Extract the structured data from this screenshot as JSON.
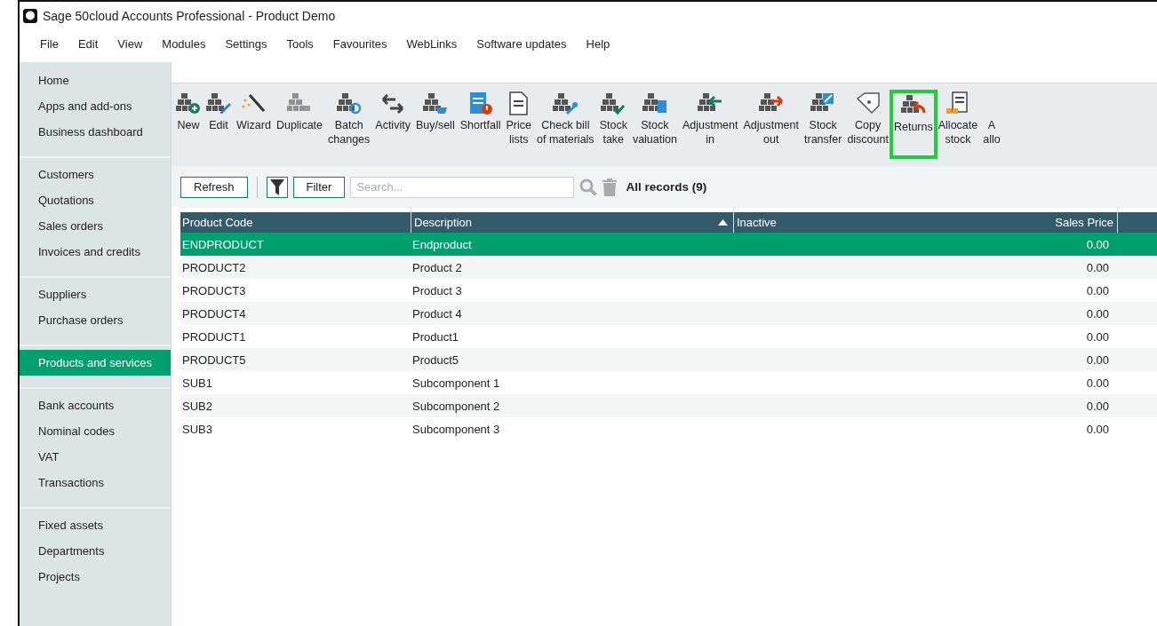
{
  "window": {
    "title": "Sage 50cloud Accounts Professional - Product Demo"
  },
  "menu": [
    "File",
    "Edit",
    "View",
    "Modules",
    "Settings",
    "Tools",
    "Favourites",
    "WebLinks",
    "Software updates",
    "Help"
  ],
  "sidebar": {
    "groups": [
      {
        "items": [
          {
            "label": "Home",
            "selected": false
          },
          {
            "label": "Apps and add-ons",
            "selected": false
          },
          {
            "label": "Business dashboard",
            "selected": false
          }
        ]
      },
      {
        "items": [
          {
            "label": "Customers",
            "selected": false
          },
          {
            "label": "Quotations",
            "selected": false
          },
          {
            "label": "Sales orders",
            "selected": false
          },
          {
            "label": "Invoices and credits",
            "selected": false
          }
        ]
      },
      {
        "items": [
          {
            "label": "Suppliers",
            "selected": false
          },
          {
            "label": "Purchase orders",
            "selected": false
          }
        ]
      },
      {
        "items": [
          {
            "label": "Products and services",
            "selected": true
          }
        ]
      },
      {
        "items": [
          {
            "label": "Bank accounts",
            "selected": false
          },
          {
            "label": "Nominal codes",
            "selected": false
          },
          {
            "label": "VAT",
            "selected": false
          },
          {
            "label": "Transactions",
            "selected": false
          }
        ]
      },
      {
        "items": [
          {
            "label": "Fixed assets",
            "selected": false
          },
          {
            "label": "Departments",
            "selected": false
          },
          {
            "label": "Projects",
            "selected": false
          }
        ]
      }
    ]
  },
  "toolbar": [
    {
      "lines": [
        "New"
      ],
      "highlighted": false
    },
    {
      "lines": [
        "Edit"
      ],
      "highlighted": false
    },
    {
      "lines": [
        "Wizard"
      ],
      "highlighted": false
    },
    {
      "lines": [
        "Duplicate"
      ],
      "highlighted": false
    },
    {
      "lines": [
        "Batch",
        "changes"
      ],
      "highlighted": false
    },
    {
      "lines": [
        "Activity"
      ],
      "highlighted": false
    },
    {
      "lines": [
        "Buy/sell"
      ],
      "highlighted": false
    },
    {
      "lines": [
        "Shortfall"
      ],
      "highlighted": false
    },
    {
      "lines": [
        "Price",
        "lists"
      ],
      "highlighted": false
    },
    {
      "lines": [
        "Check bill",
        "of materials"
      ],
      "highlighted": false
    },
    {
      "lines": [
        "Stock",
        "take"
      ],
      "highlighted": false
    },
    {
      "lines": [
        "Stock",
        "valuation"
      ],
      "highlighted": false
    },
    {
      "lines": [
        "Adjustment",
        "in"
      ],
      "highlighted": false
    },
    {
      "lines": [
        "Adjustment",
        "out"
      ],
      "highlighted": false
    },
    {
      "lines": [
        "Stock",
        "transfer"
      ],
      "highlighted": false
    },
    {
      "lines": [
        "Copy",
        "discount"
      ],
      "highlighted": false
    },
    {
      "lines": [
        "Returns"
      ],
      "highlighted": true
    },
    {
      "lines": [
        "Allocate",
        "stock"
      ],
      "highlighted": false
    },
    {
      "lines": [
        "A",
        "allo"
      ],
      "highlighted": false
    }
  ],
  "filter_bar": {
    "refresh": "Refresh",
    "filter": "Filter",
    "search": {
      "placeholder": "Search..."
    },
    "record_count": "All records (9)"
  },
  "table": {
    "columns": [
      {
        "label": "Product Code",
        "sorted": false
      },
      {
        "label": "Description",
        "sorted": true
      },
      {
        "label": "Inactive",
        "sorted": false
      },
      {
        "label": "Sales Price",
        "sorted": false
      }
    ],
    "rows": [
      {
        "code": "ENDPRODUCT",
        "description": "Endproduct",
        "price": "0.00",
        "selected": true
      },
      {
        "code": "PRODUCT2",
        "description": "Product 2",
        "price": "0.00",
        "selected": false
      },
      {
        "code": "PRODUCT3",
        "description": "Product 3",
        "price": "0.00",
        "selected": false
      },
      {
        "code": "PRODUCT4",
        "description": "Product 4",
        "price": "0.00",
        "selected": false
      },
      {
        "code": "PRODUCT1",
        "description": "Product1",
        "price": "0.00",
        "selected": false
      },
      {
        "code": "PRODUCT5",
        "description": "Product5",
        "price": "0.00",
        "selected": false
      },
      {
        "code": "SUB1",
        "description": "Subcomponent 1",
        "price": "0.00",
        "selected": false
      },
      {
        "code": "SUB2",
        "description": "Subcomponent 2",
        "price": "0.00",
        "selected": false
      },
      {
        "code": "SUB3",
        "description": "Subcomponent 3",
        "price": "0.00",
        "selected": false
      }
    ]
  }
}
